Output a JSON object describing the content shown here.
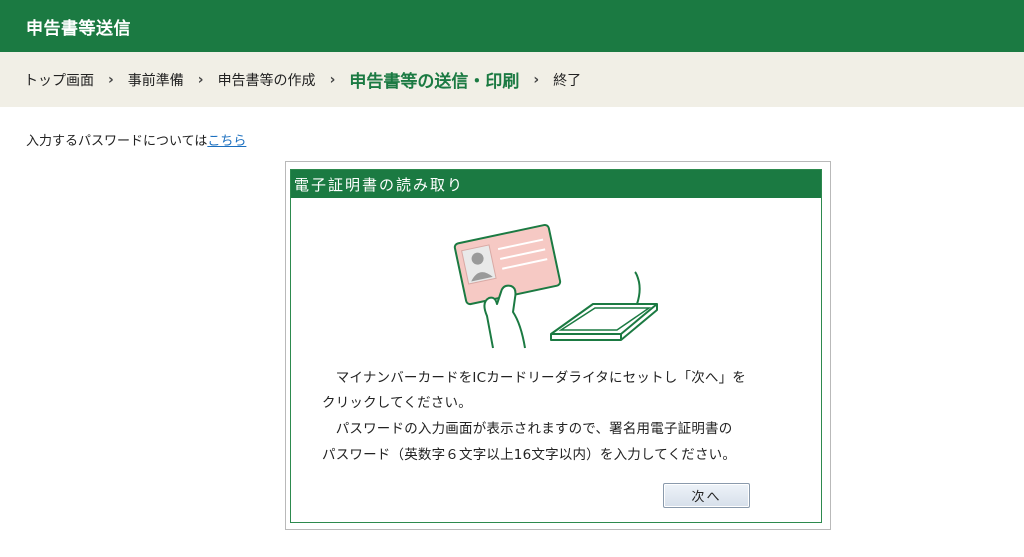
{
  "header": {
    "title": "申告書等送信"
  },
  "breadcrumb": {
    "items": [
      {
        "label": "トップ画面",
        "current": false
      },
      {
        "label": "事前準備",
        "current": false
      },
      {
        "label": "申告書等の作成",
        "current": false
      },
      {
        "label": "申告書等の送信・印刷",
        "current": true
      },
      {
        "label": "終了",
        "current": false
      }
    ],
    "separator": "›"
  },
  "note": {
    "text": "入力するパスワードについては",
    "link": "こちら"
  },
  "dialog": {
    "title": "電子証明書の読み取り",
    "lines": [
      "　マイナンバーカードをICカードリーダライタにセットし「次へ」を",
      "クリックしてください。",
      "　パスワードの入力画面が表示されますので、署名用電子証明書の",
      "パスワード（英数字６文字以上16文字以内）を入力してください。"
    ],
    "next_label": "次へ"
  },
  "colors": {
    "brand_green": "#1b7a42",
    "breadcrumb_bg": "#f1efe6",
    "card_pink": "#f6c9c4",
    "link_blue": "#1b6fbf"
  }
}
